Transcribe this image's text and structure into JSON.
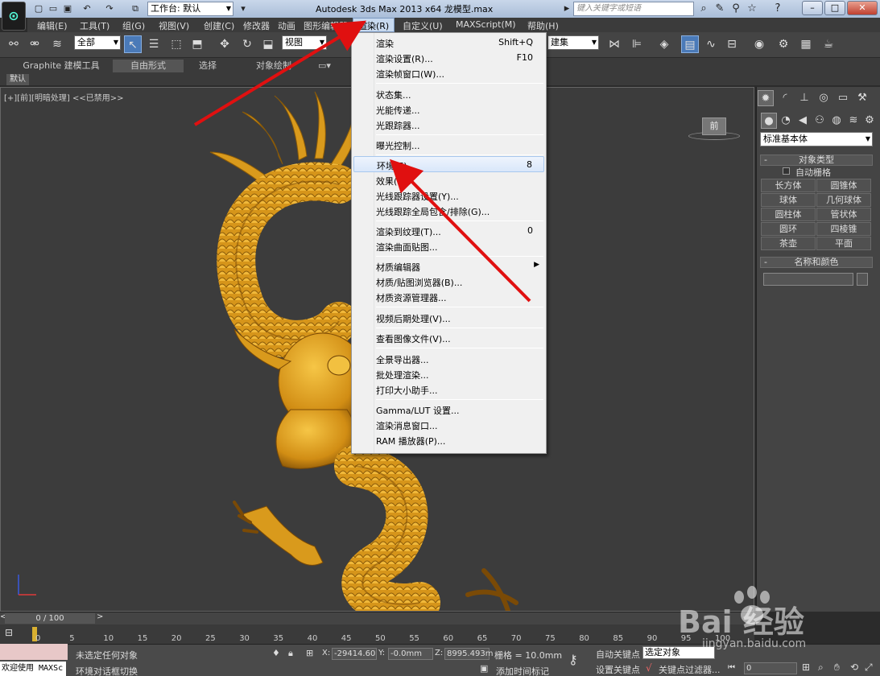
{
  "titlebar": {
    "workspace": "工作台: 默认",
    "app_title": "Autodesk 3ds Max  2013 x64      龙模型.max",
    "search_placeholder": "键入关键字或短语"
  },
  "menubar": {
    "items": [
      "编辑(E)",
      "工具(T)",
      "组(G)",
      "视图(V)",
      "创建(C)",
      "修改器",
      "动画",
      "图形编辑器",
      "渲染(R)",
      "自定义(U)",
      "MAXScript(M)",
      "帮助(H)"
    ]
  },
  "toolbar": {
    "filter_combo": "全部",
    "refcoord_combo": "视图",
    "selset_combo": "建集"
  },
  "ribbon": {
    "tabs": [
      "Graphite 建模工具",
      "自由形式",
      "选择",
      "对象绘制"
    ],
    "default_tab": "默认"
  },
  "viewport": {
    "label": "[+][前][明暗处理] <<已禁用>>",
    "viewcube_face": "前"
  },
  "command_panel": {
    "category_combo": "标准基本体",
    "object_type_title": "对象类型",
    "autogrid_label": "自动栅格",
    "object_buttons": [
      "长方体",
      "圆锥体",
      "球体",
      "几何球体",
      "圆柱体",
      "管状体",
      "圆环",
      "四棱锥",
      "茶壶",
      "平面"
    ],
    "name_color_title": "名称和颜色"
  },
  "timeline": {
    "frame_display": "0 / 100",
    "ruler_labels": [
      "0",
      "5",
      "10",
      "15",
      "20",
      "25",
      "30",
      "35",
      "40",
      "45",
      "50",
      "55",
      "60",
      "65",
      "70",
      "75",
      "80",
      "85",
      "90",
      "95",
      "100"
    ]
  },
  "statusbar": {
    "welcome": "欢迎使用 MAXSc",
    "selection_status": "未选定任何对象",
    "prompt": "环境对话框切换",
    "x_label": "X:",
    "x_value": "-29414.60",
    "y_label": "Y:",
    "y_value": "-0.0mm",
    "z_label": "Z:",
    "z_value": "8995.493m",
    "grid": "栅格 = 10.0mm",
    "add_time_tag": "添加时间标记",
    "auto_key": "自动关键点",
    "set_key": "设置关键点",
    "selection_combo": "选定对象",
    "key_filters": "关键点过滤器...",
    "frame_field": "0"
  },
  "render_menu": {
    "items": [
      {
        "label": "渲染",
        "shortcut": "Shift+Q"
      },
      {
        "label": "渲染设置(R)...",
        "shortcut": "F10"
      },
      {
        "label": "渲染帧窗口(W)...",
        "shortcut": ""
      },
      {
        "label": "状态集...",
        "shortcut": ""
      },
      {
        "label": "光能传递...",
        "shortcut": ""
      },
      {
        "label": "光跟踪器...",
        "shortcut": ""
      },
      {
        "label": "曝光控制...",
        "shortcut": ""
      },
      {
        "label": "环境(E)...",
        "shortcut": "8"
      },
      {
        "label": "效果(F)...",
        "shortcut": ""
      },
      {
        "label": "光线跟踪器设置(Y)...",
        "shortcut": ""
      },
      {
        "label": "光线跟踪全局包含/排除(G)...",
        "shortcut": ""
      },
      {
        "label": "渲染到纹理(T)...",
        "shortcut": "0"
      },
      {
        "label": "渲染曲面贴图...",
        "shortcut": ""
      },
      {
        "label": "材质编辑器",
        "shortcut": ""
      },
      {
        "label": "材质/贴图浏览器(B)...",
        "shortcut": ""
      },
      {
        "label": "材质资源管理器...",
        "shortcut": ""
      },
      {
        "label": "视频后期处理(V)...",
        "shortcut": ""
      },
      {
        "label": "查看图像文件(V)...",
        "shortcut": ""
      },
      {
        "label": "全景导出器...",
        "shortcut": ""
      },
      {
        "label": "批处理渲染...",
        "shortcut": ""
      },
      {
        "label": "打印大小助手...",
        "shortcut": ""
      },
      {
        "label": "Gamma/LUT 设置...",
        "shortcut": ""
      },
      {
        "label": "渲染消息窗口...",
        "shortcut": ""
      },
      {
        "label": "RAM 播放器(P)...",
        "shortcut": ""
      }
    ]
  },
  "watermark": {
    "brand": "Bai 经验",
    "url": "jingyan.baidu.com"
  },
  "colors": {
    "dragon": "#d99a1c",
    "arrow": "#e01010",
    "menu_highlight": "#d9e7fa"
  }
}
